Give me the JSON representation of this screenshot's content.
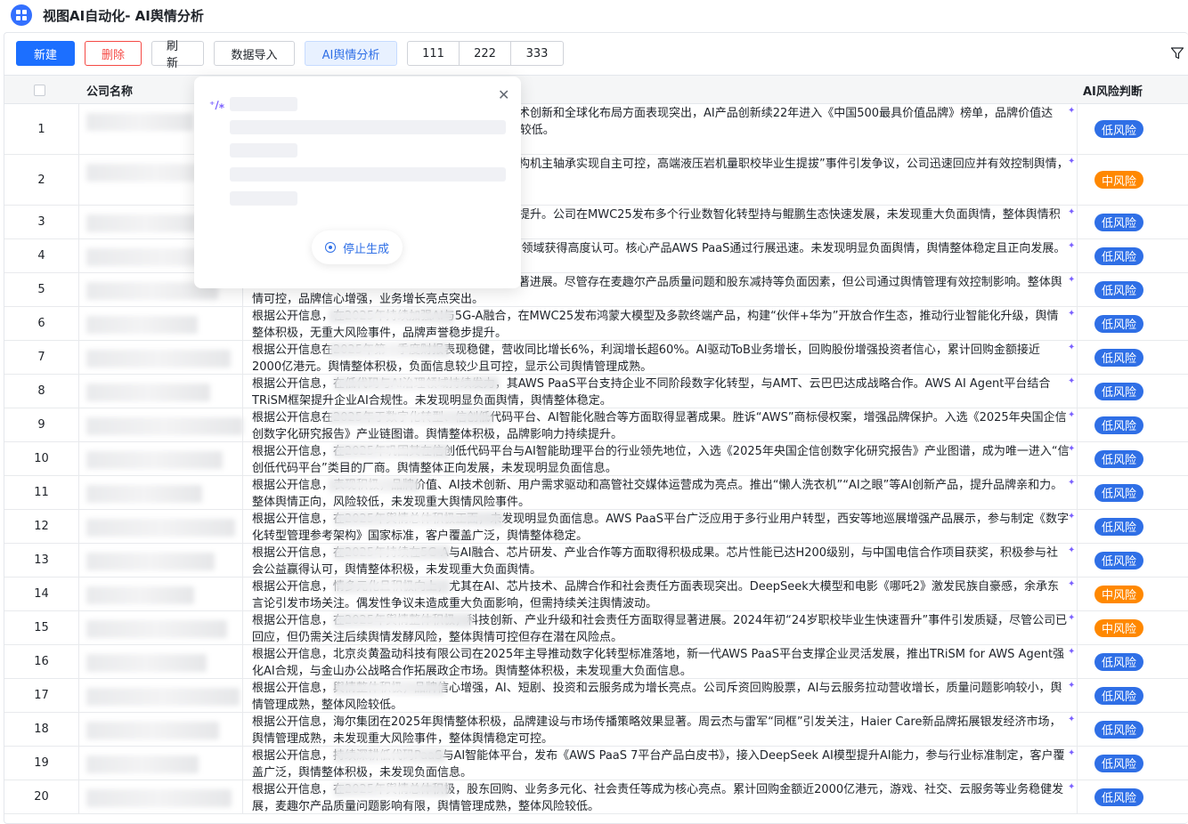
{
  "title": "视图AI自动化- AI舆情分析",
  "toolbar": {
    "new": "新建",
    "delete": "删除",
    "refresh": "刷新",
    "import": "数据导入",
    "ai_analysis": "AI舆情分析",
    "seg": [
      "111",
      "222",
      "333"
    ]
  },
  "table": {
    "col_company": "公司名称",
    "col_risk": "AI风险判断",
    "rows": [
      {
        "idx": "1",
        "text": "体积极，未发现显著负面信息。公司在品牌价值、技术创新和全球化布局方面表现突出，AI产品创新续22年进入《中国500最具价值品牌》榜单，品牌价值达5735.17亿元，位列前三。生态转型、用户向且风险较低。",
        "risk": "低风险",
        "level": "low"
      },
      {
        "idx": "2",
        "text": "舆情整体积极，品牌价值和市场影响力持续提升。盾构机主轴承实现自主可控，高端液压岩机量职校毕业生提拔”事件引发争议，公司迅速回应并有效控制舆情，整体舆情正面为主，舆情管理成",
        "risk": "中风险",
        "level": "mid"
      },
      {
        "idx": "3",
        "text": "整体向好，技术创新和产业合作推动品牌影响力持续提升。公司在MWC25发布多个行业数智化转型持与鲲鹏生态快速发展，未发现重大负面舆情，整体舆情积极稳定。",
        "risk": "低风险",
        "level": "low"
      },
      {
        "idx": "4",
        "text": "25年舆情表现积极，尤其在数字化转型和低代码平台领域获得高度认可。核心产品AWS PaaS通过行展迅速。未发现明显负面舆情，舆情整体稳定且正向发展。",
        "risk": "低风险",
        "level": "low"
      },
      {
        "idx": "5",
        "text": "舆情整体向好，AI、短剧、投资与云服务业务取得显著进展。尽管存在麦趣尔产品质量问题和股东减持等负面因素，但公司通过舆情管理有效控制影响。整体舆情可控，品牌信心增强，业务增长亮点突出。",
        "risk": "低风险",
        "level": "low"
      },
      {
        "idx": "6",
        "text": "根据公开信息，在2025年持续加强AI与5G-A融合，在MWC25发布鸿蒙大模型及多款终端产品，构建“伙伴+华为”开放合作生态，推动行业智能化升级，舆情整体积极，无重大风险事件，品牌声誉稳步提升。",
        "risk": "低风险",
        "level": "low"
      },
      {
        "idx": "7",
        "text": "根据公开信息在2025年第一季度财报表现稳健，营收同比增长6%，利润增长超60%。AI驱动ToB业务增长，回购股份增强投资者信心，累计回购金额接近2000亿港元。舆情整体积极，负面信息较少且可控，显示公司舆情管理成熟。",
        "risk": "低风险",
        "level": "low"
      },
      {
        "idx": "8",
        "text": "根据公开信息，在低代码与AI治理领域持续发力，其AWS PaaS平台支持企业不同阶段数字化转型，与AMT、云巴巴达成战略合作。AWS AI Agent平台结合TRiSM框架提升企业AI合规性。未发现明显负面舆情，舆情整体稳定。",
        "risk": "低风险",
        "level": "low"
      },
      {
        "idx": "9",
        "text": "根据公开信息在2025年于数字化转型、信创低代码平台、AI智能化融合等方面取得显著成果。胜诉“AWS”商标侵权案，增强品牌保护。入选《2025年央国企信创数字化研究报告》产业链图谱。舆情整体积极，品牌影响力持续提升。",
        "risk": "低风险",
        "level": "low"
      },
      {
        "idx": "10",
        "text": "根据公开信息，在2025年巩固其在信创低代码平台与AI智能助理平台的行业领先地位，入选《2025年央国企信创数字化研究报告》产业图谱，成为唯一进入“信创低代码平台”类目的厂商。舆情整体正向发展，未发现明显负面信息。",
        "risk": "低风险",
        "level": "low"
      },
      {
        "idx": "11",
        "text": "根据公开信息，表现积极，品牌价值、AI技术创新、用户需求驱动和高管社交媒体运营成为亮点。推出“懒人洗衣机”“AI之眼”等AI创新产品，提升品牌亲和力。整体舆情正向，风险较低，未发现重大舆情风险事件。",
        "risk": "低风险",
        "level": "low"
      },
      {
        "idx": "12",
        "text": "根据公开信息，在2025年舆情总体积极正面，未发现明显负面信息。AWS PaaS平台广泛应用于多行业用户转型，西安等地巡展增强产品展示，参与制定《数字化转型管理参考架构》国家标准，客户覆盖广泛，舆情整体稳定。",
        "risk": "低风险",
        "level": "low"
      },
      {
        "idx": "13",
        "text": "根据公开信息，在2025年持续在5G-A与AI融合、芯片研发、产业合作等方面取得积极成果。芯片性能已达H200级别，与中国电信合作项目获奖，积极参与社会公益赢得认可，舆情整体积极，未发现重大负面舆情。",
        "risk": "低风险",
        "level": "low"
      },
      {
        "idx": "14",
        "text": "根据公开信息，情多元化且积极向上，尤其在AI、芯片技术、品牌合作和社会责任方面表现突出。DeepSeek大模型和电影《哪吒2》激发民族自豪感，余承东言论引发市场关注。偶发性争议未造成重大负面影响，但需持续关注舆情波动。",
        "risk": "中风险",
        "level": "mid"
      },
      {
        "idx": "15",
        "text": "根据公开信息，在2025年舆情整体积极，科技创新、产业升级和社会责任方面取得显著进展。2024年初“24岁职校毕业生快速晋升”事件引发质疑，尽管公司已回应，但仍需关注后续舆情发酵风险，整体舆情可控但存在潜在风险点。",
        "risk": "中风险",
        "level": "mid"
      },
      {
        "idx": "16",
        "text": "根据公开信息，北京炎黄盈动科技有限公司在2025年主导推动数字化转型标准落地，新一代AWS PaaS平台支撑企业灵活发展，推出TRiSM for AWS Agent强化AI合规，与金山办公战略合作拓展政企市场。舆情整体积极，未发现重大负面信息。",
        "risk": "低风险",
        "level": "low"
      },
      {
        "idx": "17",
        "text": "根据公开信息，舆情整体积极，品牌信心增强，AI、短剧、投资和云服务成为增长亮点。公司斥资回购股票，AI与云服务拉动营收增长，质量问题影响较小，舆情管理成熟，整体风险较低。",
        "risk": "低风险",
        "level": "low"
      },
      {
        "idx": "18",
        "text": "根据公开信息，海尔集团在2025年舆情整体积极，品牌建设与市场传播策略效果显著。周云杰与雷军“同框”引发关注，Haier Care新品牌拓展银发经济市场，舆情管理成熟，未发现重大风险事件，整体舆情稳定可控。",
        "risk": "低风险",
        "level": "low"
      },
      {
        "idx": "19",
        "text": "根据公开信息，持续深耕低代码PaaS与AI智能体平台，发布《AWS PaaS 7平台产品白皮书》，接入DeepSeek AI模型提升AI能力，参与行业标准制定，客户覆盖广泛，舆情整体积极，未发现负面信息。",
        "risk": "低风险",
        "level": "low"
      },
      {
        "idx": "20",
        "text": "根据公开信息，在2025年舆情总体积极，股东回购、业务多元化、社会责任等成为核心亮点。累计回购金额近2000亿港元，游戏、社交、云服务等业务稳健发展，麦趣尔产品质量问题影响有限，舆情管理成熟，整体风险较低。",
        "risk": "低风险",
        "level": "low"
      }
    ]
  },
  "popup": {
    "stop_label": "停止生成"
  },
  "colors": {
    "primary": "#1c6fff",
    "danger": "#f54a45",
    "low_risk": "#2f6fe6",
    "mid_risk": "#ff8800"
  }
}
